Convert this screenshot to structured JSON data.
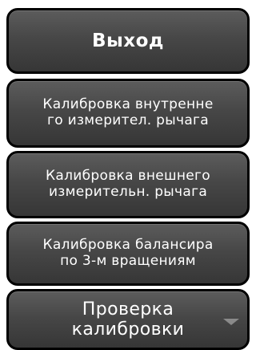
{
  "menu": {
    "exit": {
      "lines": [
        "Выход"
      ]
    },
    "calibrate_inner": {
      "lines": [
        "Калибровка внутренне",
        "го измерител. рычага"
      ]
    },
    "calibrate_outer": {
      "lines": [
        "Калибровка внешнего",
        "измерительн. рычага"
      ]
    },
    "calibrate_balance": {
      "lines": [
        "Калибровка балансира",
        "по 3-м вращениям"
      ]
    },
    "check_calibration": {
      "lines": [
        "Проверка",
        "калибровки"
      ],
      "icon": "chevron-down-icon"
    }
  },
  "colors": {
    "button_top": "#5c5c5c",
    "button_bottom": "#363636",
    "border": "#000000",
    "text": "#ffffff",
    "arrow": "#8a8a8a"
  }
}
